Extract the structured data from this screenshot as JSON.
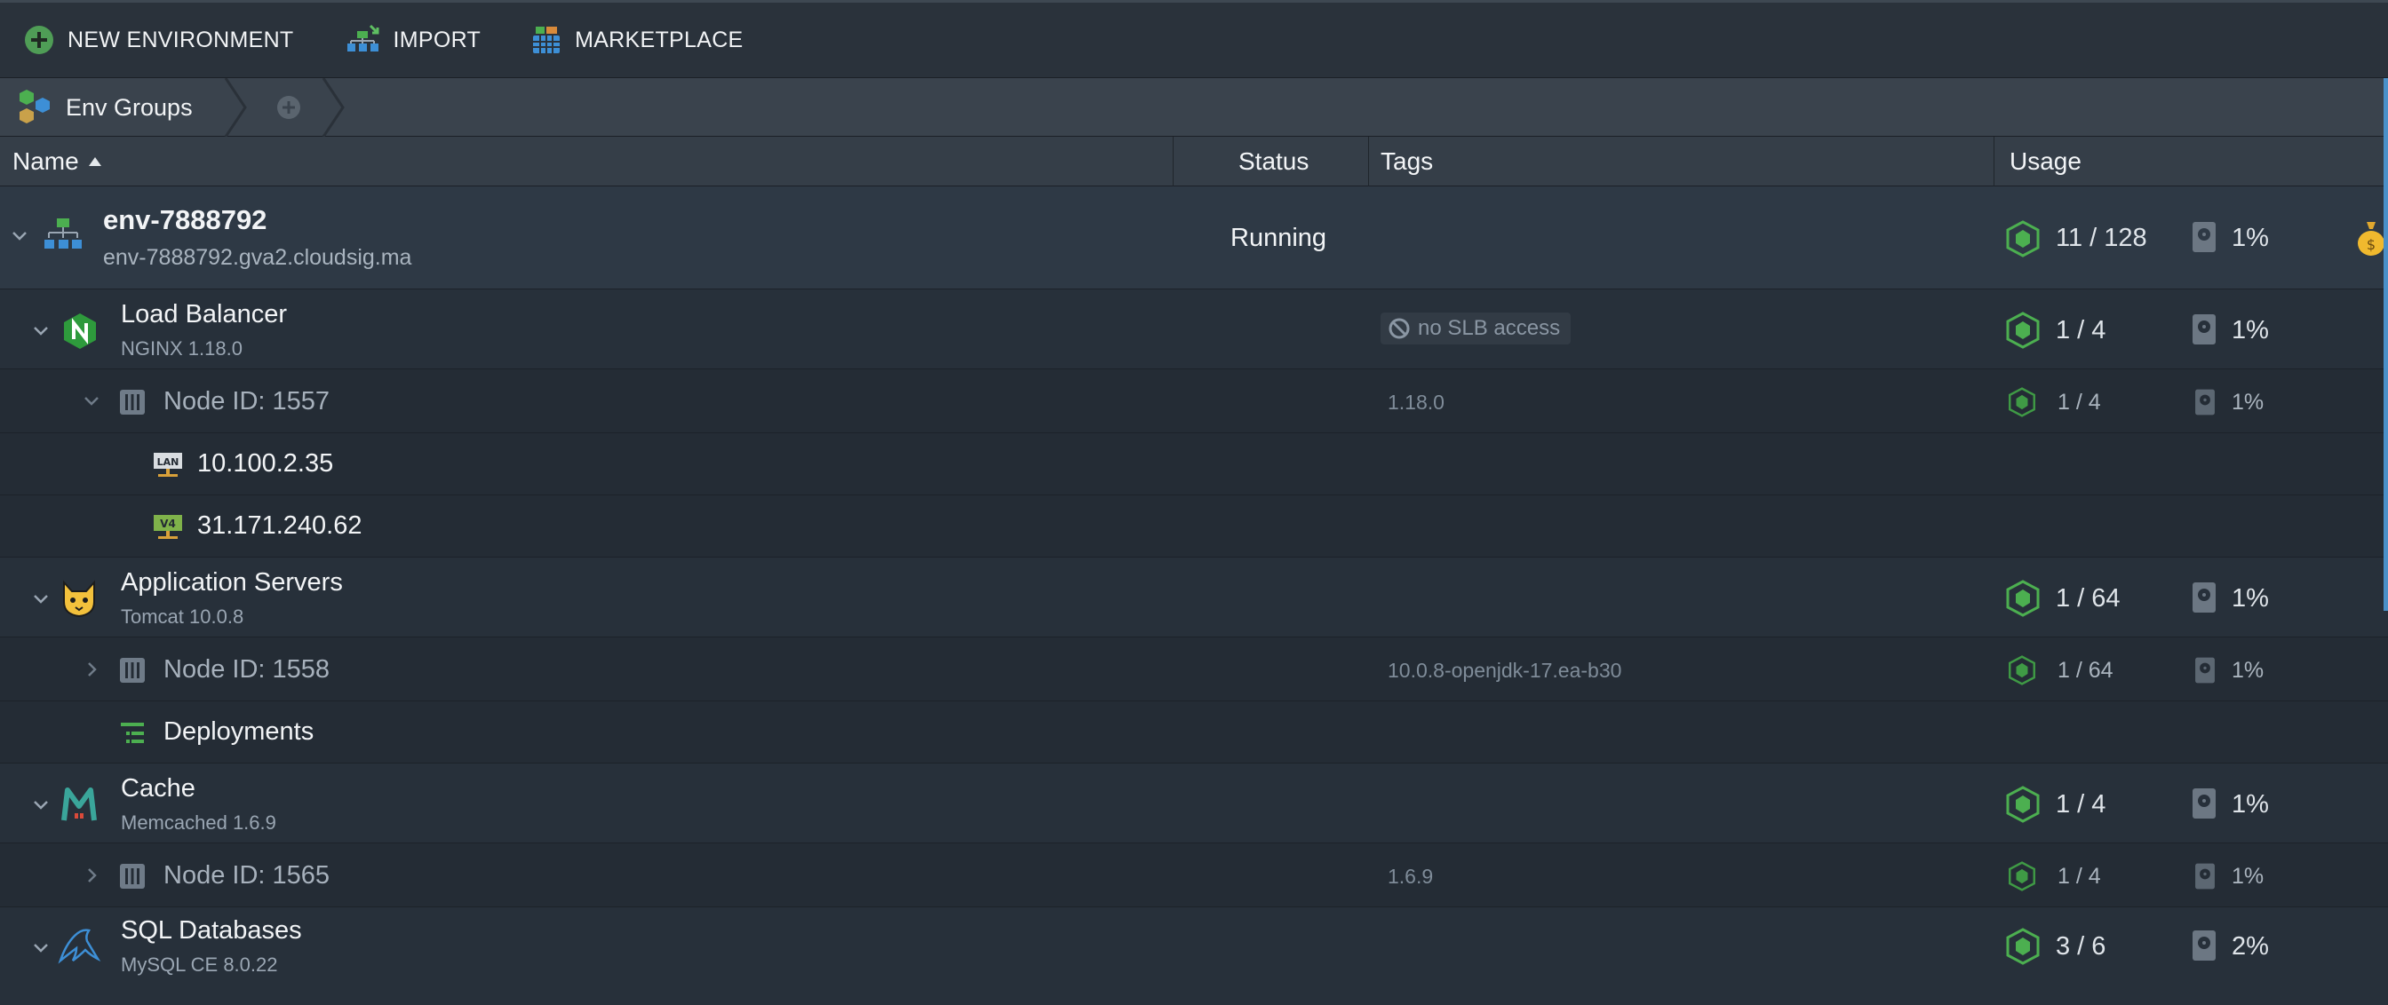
{
  "toolbar": {
    "new_env": "NEW ENVIRONMENT",
    "import": "IMPORT",
    "marketplace": "MARKETPLACE"
  },
  "breadcrumb": {
    "env_groups": "Env Groups"
  },
  "columns": {
    "name": "Name",
    "status": "Status",
    "tags": "Tags",
    "usage": "Usage"
  },
  "environment": {
    "name": "env-7888792",
    "domain": "env-7888792.gva2.cloudsig.ma",
    "status": "Running",
    "cloudlets": "11 / 128",
    "disk": "1%"
  },
  "load_balancer": {
    "name": "Load Balancer",
    "version": "NGINX 1.18.0",
    "tag_badge": "no SLB access",
    "cloudlets": "1 / 4",
    "disk": "1%",
    "node": {
      "id": "Node ID: 1557",
      "tag": "1.18.0",
      "cloudlets": "1 / 4",
      "disk": "1%"
    },
    "ips": [
      {
        "label": "10.100.2.35",
        "icon": "lan-ip-icon"
      },
      {
        "label": "31.171.240.62",
        "icon": "public-ipv4-icon"
      }
    ]
  },
  "app_servers": {
    "name": "Application Servers",
    "version": "Tomcat 10.0.8",
    "cloudlets": "1 / 64",
    "disk": "1%",
    "node": {
      "id": "Node ID: 1558",
      "tag": "10.0.8-openjdk-17.ea-b30",
      "cloudlets": "1 / 64",
      "disk": "1%"
    },
    "deployments": "Deployments"
  },
  "cache": {
    "name": "Cache",
    "version": "Memcached 1.6.9",
    "cloudlets": "1 / 4",
    "disk": "1%",
    "node": {
      "id": "Node ID: 1565",
      "tag": "1.6.9",
      "cloudlets": "1 / 4",
      "disk": "1%"
    }
  },
  "sql": {
    "name": "SQL Databases",
    "version": "MySQL CE 8.0.22",
    "cloudlets": "3 / 6",
    "disk": "2%"
  },
  "colors": {
    "accent_green": "#4caf50",
    "brand_blue": "#3d8fd6",
    "background": "#232a33"
  }
}
